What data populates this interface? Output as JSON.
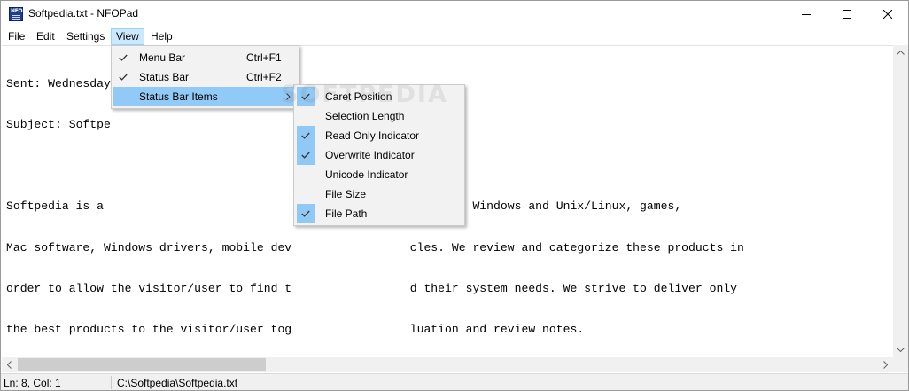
{
  "window": {
    "title": "Softpedia.txt - NFOPad",
    "app_icon_text": "NFO"
  },
  "menubar": {
    "file": "File",
    "edit": "Edit",
    "settings": "Settings",
    "view": "View",
    "help": "Help"
  },
  "editor": {
    "lines": [
      "Sent: Wednesday",
      "Subject: Softpe",
      "",
      "Softpedia is a                                  tware programs for Windows and Unix/Linux, games,",
      "Mac software, Windows drivers, mobile dev                 cles. We review and categorize these products in",
      "order to allow the visitor/user to find t                 d their system needs. We strive to deliver only",
      "the best products to the visitor/user tog                 luation and review notes."
    ]
  },
  "watermark": "SOFTPEDIA",
  "view_menu": {
    "items": [
      {
        "label": "Menu Bar",
        "shortcut": "Ctrl+F1",
        "checked": true
      },
      {
        "label": "Status Bar",
        "shortcut": "Ctrl+F2",
        "checked": true
      },
      {
        "label": "Status Bar Items",
        "shortcut": "",
        "checked": false,
        "has_submenu": true,
        "highlighted": true
      }
    ]
  },
  "status_items_menu": {
    "items": [
      {
        "label": "Caret Position",
        "checked": true
      },
      {
        "label": "Selection Length",
        "checked": false
      },
      {
        "label": "Read Only Indicator",
        "checked": true
      },
      {
        "label": "Overwrite Indicator",
        "checked": true
      },
      {
        "label": "Unicode Indicator",
        "checked": false
      },
      {
        "label": "File Size",
        "checked": false
      },
      {
        "label": "File Path",
        "checked": true
      }
    ]
  },
  "statusbar": {
    "caret": "Ln: 8, Col: 1",
    "path": "C:\\Softpedia\\Softpedia.txt"
  },
  "colors": {
    "menu_highlight": "#91c9f7",
    "check_bg": "#90c8f6",
    "menubar_active": "#cce8ff"
  },
  "icons": [
    "app-icon",
    "minimize-icon",
    "maximize-icon",
    "close-icon",
    "check-icon",
    "chevron-right-icon",
    "scroll-up-icon",
    "scroll-down-icon",
    "scroll-left-icon",
    "scroll-right-icon"
  ]
}
